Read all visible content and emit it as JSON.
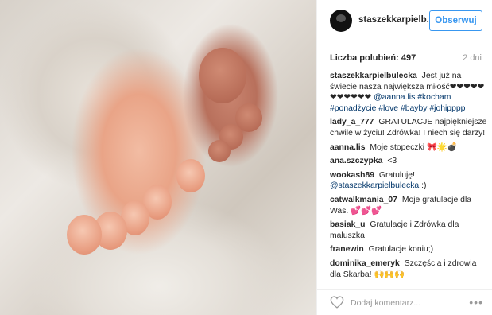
{
  "post": {
    "username": "staszekkarpielb...",
    "follow_label": "Obserwuj",
    "likes_text": "Liczba polubień: 497",
    "time_ago": "2 dni"
  },
  "comments": [
    {
      "user": "staszekkarpielbulecka",
      "text": "Jest już na świecie nasza największa miłość❤❤❤❤❤❤❤❤❤❤❤",
      "mentions": "@aanna.lis",
      "tags": "#kocham #ponadżycie #love #bayby #johipppp"
    },
    {
      "user": "lady_a_777",
      "text": "GRATULACJE najpiękniejsze chwile w życiu! Zdrówka! I niech się darzy!"
    },
    {
      "user": "aanna.lis",
      "text": "Moje stopeczki 🎀🌟💣"
    },
    {
      "user": "ana.szczypka",
      "text": "<3"
    },
    {
      "user": "wookash89",
      "text": "Gratuluję!",
      "mentions": "@staszekkarpielbulecka",
      "suffix": ":)"
    },
    {
      "user": "catwalkmania_07",
      "text": "Moje gratulacje dla Was.",
      "suffix": "💕💕💕"
    },
    {
      "user": "basiak_u",
      "text": "Gratulacje i Zdrówka dla maluszka"
    },
    {
      "user": "franewin",
      "text": "Gratulacje koniu;)"
    },
    {
      "user": "dominika_emeryk",
      "text": "Szczęścia i zdrowia dla Skarba!",
      "suffix": "🙌🙌🙌"
    }
  ],
  "footer": {
    "placeholder": "Dodaj komentarz...",
    "more_icon": "•••"
  },
  "colors": {
    "accent": "#3897f0",
    "mention": "#003569",
    "muted": "#999999"
  },
  "icons": {
    "like": "heart-icon",
    "more": "more-options-icon"
  }
}
